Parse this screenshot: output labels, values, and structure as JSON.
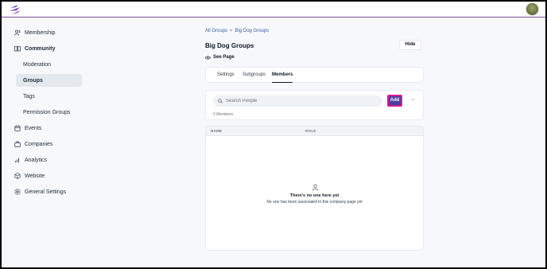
{
  "topbar": {
    "logo_icon": "lightning-stripes-logo",
    "avatar_icon": "user-avatar",
    "accent_color": "#7b4fa0"
  },
  "sidebar": {
    "membership": "Membership",
    "community": "Community",
    "moderation": "Moderation",
    "groups": "Groups",
    "tags": "Tags",
    "permission_groups": "Permission Groups",
    "events": "Events",
    "companies": "Companies",
    "analytics": "Analytics",
    "website": "Website",
    "general_settings": "General Settings"
  },
  "breadcrumb": {
    "root": "All Groups",
    "separator": "<",
    "current": "Big Dog Groups"
  },
  "page": {
    "title": "Big Dog Groups",
    "hide_label": "Hide",
    "see_page_label": "See Page"
  },
  "tabs": {
    "settings": "Settings",
    "subgroups": "Subgroups",
    "members": "Members",
    "active": "members"
  },
  "members": {
    "search_placeholder": "Search People",
    "add_label": "Add",
    "more_label": "···",
    "count_text": "0 Members",
    "add_button_color": "#4a3ea0",
    "highlight_color": "#d81b8c"
  },
  "table": {
    "columns": [
      "NAME",
      "ROLE"
    ],
    "empty_title": "There's no one here yet",
    "empty_subtitle": "No one has been associated to this company page yet"
  }
}
